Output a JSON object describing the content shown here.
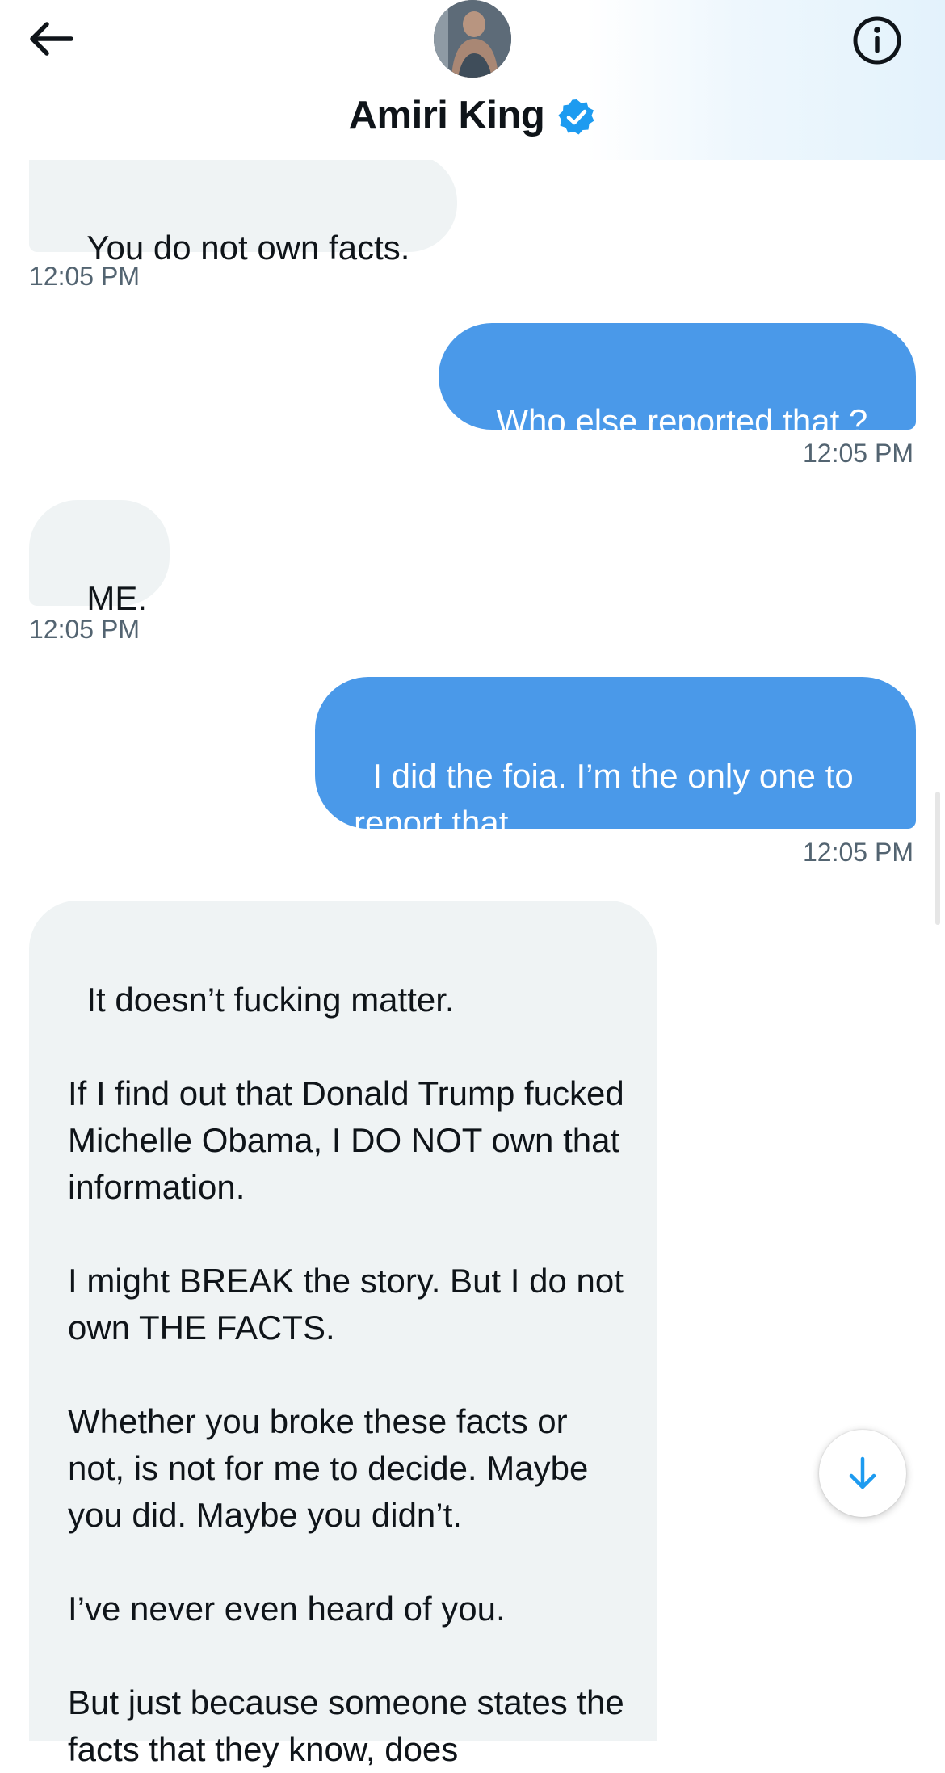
{
  "header": {
    "contact_name": "Amiri King",
    "verified": true,
    "icons": {
      "back": "arrow-left-icon",
      "info": "info-circle-icon",
      "verified": "verified-badge-icon",
      "scroll_down": "arrow-down-icon"
    }
  },
  "colors": {
    "outgoing_bubble": "#4a99e9",
    "incoming_bubble": "#eff3f4",
    "verified_badge": "#1d9bf0",
    "timestamp": "#536471"
  },
  "messages": [
    {
      "direction": "incoming",
      "text": "You do not own facts.",
      "time": "12:05 PM"
    },
    {
      "direction": "outgoing",
      "text": "Who else reported that ?",
      "time": "12:05 PM"
    },
    {
      "direction": "incoming",
      "text": "ME.",
      "time": "12:05 PM"
    },
    {
      "direction": "outgoing",
      "text": "I did the foia. I’m the only one to report that",
      "time": "12:05 PM"
    },
    {
      "direction": "incoming",
      "text": "It doesn’t fucking matter.\n\nIf I find out that Donald Trump fucked Michelle Obama, I DO NOT own that information.\n\nI might BREAK the story. But I do not own THE FACTS.\n\nWhether you broke these facts or not, is not for me to decide. Maybe you did. Maybe you didn’t.\n\nI’ve never even heard of you.\n\nBut just because someone states the facts that they know, does"
    }
  ]
}
